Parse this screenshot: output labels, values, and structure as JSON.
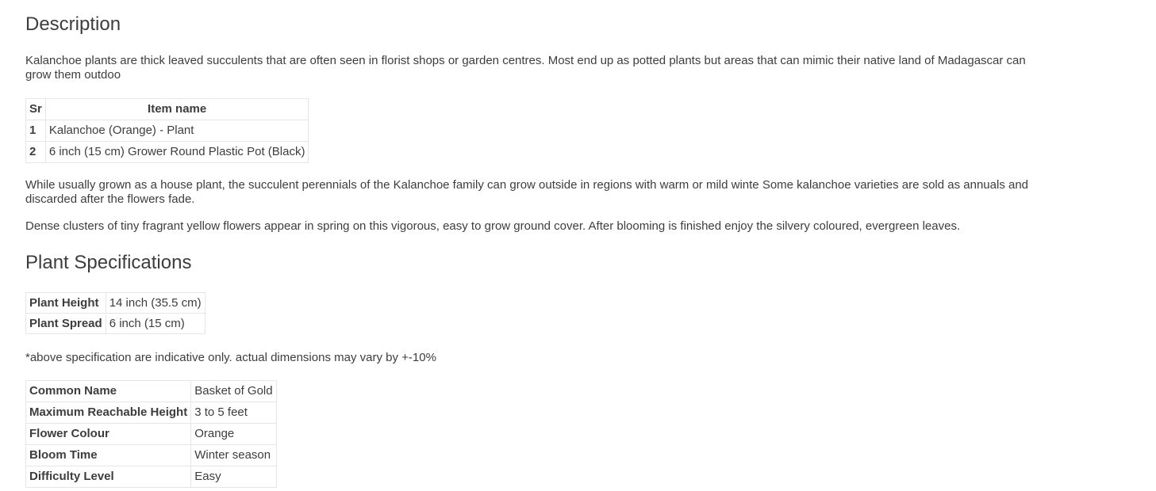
{
  "description": {
    "heading": "Description",
    "intro": "Kalanchoe plants are thick leaved succulents that are often seen in florist shops or garden centres. Most end up as potted plants but areas that can mimic their native land of Madagascar can grow them outdoo",
    "items_table": {
      "headers": [
        "Sr",
        "Item name"
      ],
      "rows": [
        {
          "sr": "1",
          "name": "Kalanchoe (Orange) - Plant"
        },
        {
          "sr": "2",
          "name": "6 inch (15 cm) Grower Round Plastic Pot (Black)"
        }
      ]
    },
    "para2": "While usually grown as a house plant, the succulent perennials of the Kalanchoe family can grow outside in regions with warm or mild winte Some kalanchoe varieties are sold as annuals and discarded after the flowers fade.",
    "para3": "Dense clusters of tiny fragrant yellow flowers appear in spring on this vigorous, easy to grow ground cover. After blooming is finished enjoy the silvery coloured, evergreen leaves."
  },
  "specifications": {
    "heading": "Plant Specifications",
    "rows": [
      {
        "label": "Plant Height",
        "value": "14 inch (35.5 cm)"
      },
      {
        "label": "Plant Spread",
        "value": "6 inch (15 cm)"
      }
    ],
    "note": "*above specification are indicative only. actual dimensions may vary by +-10%"
  },
  "details": {
    "rows": [
      {
        "label": "Common Name",
        "value": "Basket of Gold"
      },
      {
        "label": "Maximum Reachable Height",
        "value": "3 to 5 feet"
      },
      {
        "label": "Flower Colour",
        "value": "Orange"
      },
      {
        "label": "Bloom Time",
        "value": "Winter season"
      },
      {
        "label": "Difficulty Level",
        "value": "Easy"
      }
    ]
  },
  "colors": {
    "text": "#3d3d3d",
    "border": "#e6e6e6",
    "background": "#ffffff"
  }
}
